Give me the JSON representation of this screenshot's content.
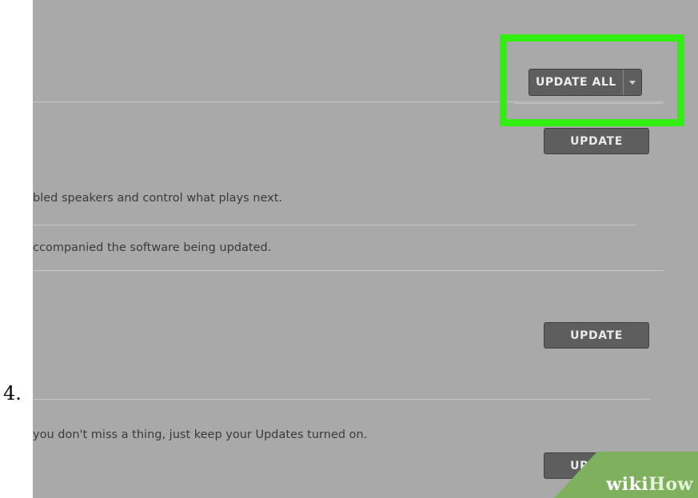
{
  "step": {
    "number": "4."
  },
  "updates": {
    "update_all_label": "UPDATE ALL",
    "rows": [
      {
        "button_label": "UPDATE",
        "description": "bled speakers and control what plays next."
      },
      {
        "description": "ccompanied the software being updated."
      },
      {
        "button_label": "UPDATE"
      },
      {
        "description": "you don't miss a thing, just keep your Updates turned on.",
        "button_label": "UPDATE"
      }
    ]
  },
  "watermark": {
    "part1": "wiki",
    "part2": "How"
  },
  "colors": {
    "highlight": "#33ee11",
    "button": "#5e5e5e",
    "background": "#a9a9a9",
    "watermark": "#7fb05d"
  }
}
